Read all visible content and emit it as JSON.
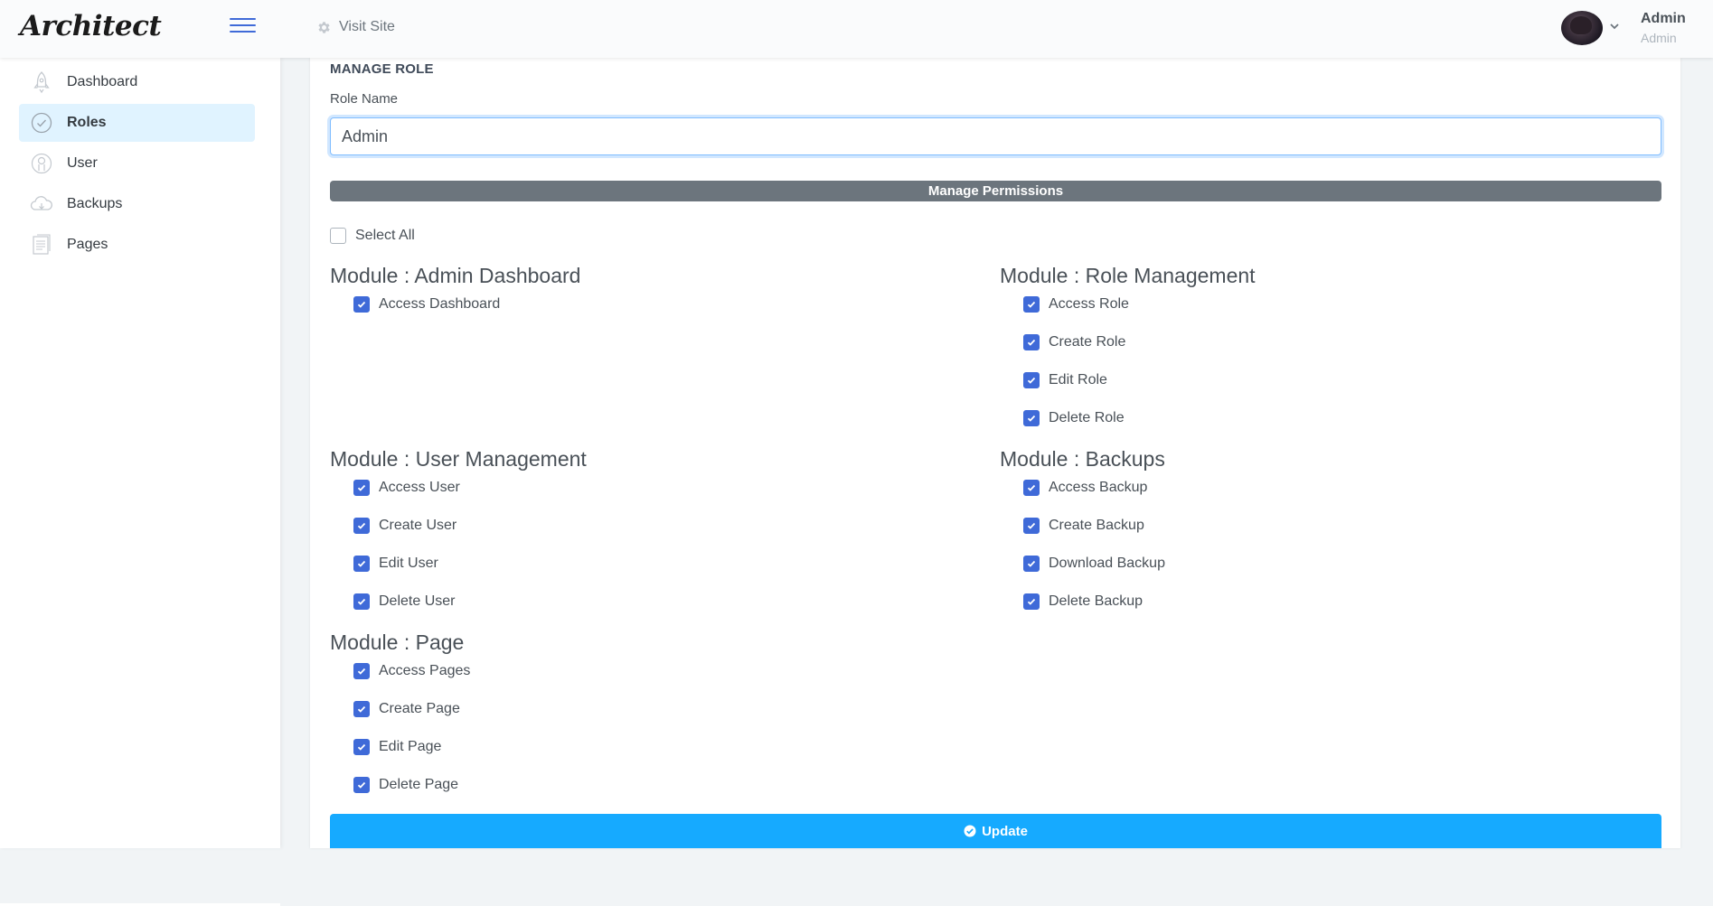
{
  "app": {
    "logo": "Architect"
  },
  "header": {
    "visit_site": "Visit Site",
    "user_name": "Admin",
    "user_role": "Admin"
  },
  "sidebar": {
    "items": [
      {
        "label": "Dashboard",
        "icon": "rocket-icon",
        "active": false
      },
      {
        "label": "Roles",
        "icon": "check-circle-icon",
        "active": true
      },
      {
        "label": "User",
        "icon": "user-icon",
        "active": false
      },
      {
        "label": "Backups",
        "icon": "cloud-icon",
        "active": false
      },
      {
        "label": "Pages",
        "icon": "page-icon",
        "active": false
      }
    ]
  },
  "form": {
    "title": "MANAGE ROLE",
    "role_name_label": "Role Name",
    "role_name_value": "Admin",
    "permissions_header": "Manage Permissions",
    "select_all_label": "Select All",
    "select_all_checked": false,
    "update_label": "Update"
  },
  "modules": [
    {
      "title": "Module : Admin Dashboard",
      "permissions": [
        {
          "label": "Access Dashboard",
          "checked": true
        }
      ]
    },
    {
      "title": "Module : Role Management",
      "permissions": [
        {
          "label": "Access Role",
          "checked": true
        },
        {
          "label": "Create Role",
          "checked": true
        },
        {
          "label": "Edit Role",
          "checked": true
        },
        {
          "label": "Delete Role",
          "checked": true
        }
      ]
    },
    {
      "title": "Module : User Management",
      "permissions": [
        {
          "label": "Access User",
          "checked": true
        },
        {
          "label": "Create User",
          "checked": true
        },
        {
          "label": "Edit User",
          "checked": true
        },
        {
          "label": "Delete User",
          "checked": true
        }
      ]
    },
    {
      "title": "Module : Backups",
      "permissions": [
        {
          "label": "Access Backup",
          "checked": true
        },
        {
          "label": "Create Backup",
          "checked": true
        },
        {
          "label": "Download Backup",
          "checked": true
        },
        {
          "label": "Delete Backup",
          "checked": true
        }
      ]
    },
    {
      "title": "Module : Page",
      "permissions": [
        {
          "label": "Access Pages",
          "checked": true
        },
        {
          "label": "Create Page",
          "checked": true
        },
        {
          "label": "Edit Page",
          "checked": true
        },
        {
          "label": "Delete Page",
          "checked": true
        }
      ]
    }
  ],
  "colors": {
    "accent": "#3f6ad8",
    "update_button": "#16aaff",
    "permissions_bar": "#6c757d",
    "active_nav": "#e0f3ff"
  }
}
